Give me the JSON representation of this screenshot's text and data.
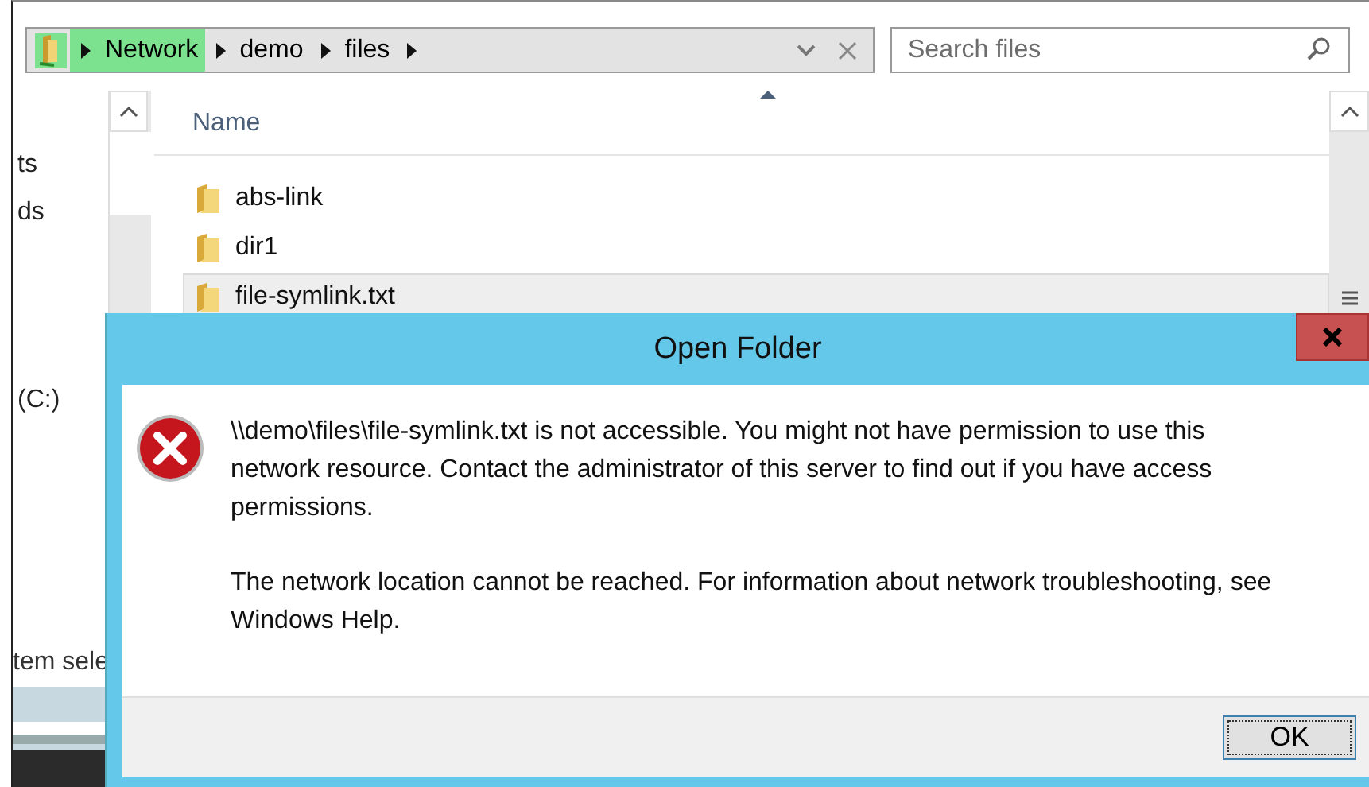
{
  "address_bar": {
    "crumbs": [
      {
        "label": "Network",
        "highlighted": true
      },
      {
        "label": "demo",
        "highlighted": false
      },
      {
        "label": "files",
        "highlighted": false
      }
    ]
  },
  "search": {
    "placeholder": "Search files"
  },
  "nav_pane": {
    "groups": [
      [
        "ts",
        "ds"
      ],
      [
        "(C:)"
      ]
    ]
  },
  "file_list": {
    "columns": [
      "Name"
    ],
    "rows": [
      {
        "name": "abs-link",
        "selected": false
      },
      {
        "name": "dir1",
        "selected": false
      },
      {
        "name": "file-symlink.txt",
        "selected": true
      }
    ]
  },
  "status_bar": "tem sele",
  "dialog": {
    "title": "Open Folder",
    "paragraphs": [
      "\\\\demo\\files\\file-symlink.txt is not accessible. You might not have permission to use this network resource. Contact the administrator of this server to find out if you have access permissions.",
      "The network location cannot be reached. For information about network troubleshooting, see Windows Help."
    ],
    "buttons": [
      {
        "label": "OK",
        "focused": true
      }
    ]
  }
}
